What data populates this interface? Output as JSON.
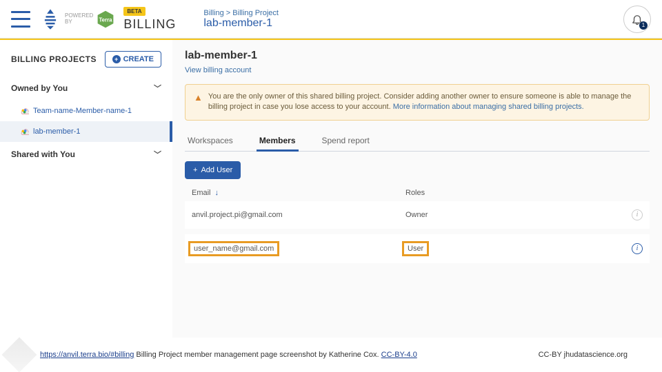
{
  "header": {
    "powered_label": "POWERED\nBY",
    "beta_label": "BETA",
    "billing_label": "BILLING",
    "breadcrumb_billing": "Billing",
    "breadcrumb_sep": ">",
    "breadcrumb_project": "Billing Project",
    "project_name": "lab-member-1",
    "notification_count": "1"
  },
  "sidebar": {
    "title": "BILLING PROJECTS",
    "create_label": "CREATE",
    "owned_label": "Owned by You",
    "shared_label": "Shared with You",
    "projects": [
      {
        "name": "Team-name-Member-name-1"
      },
      {
        "name": "lab-member-1"
      }
    ]
  },
  "main": {
    "title": "lab-member-1",
    "view_link": "View billing account",
    "warning_text": "You are the only owner of this shared billing project. Consider adding another owner to ensure someone is able to manage the billing project in case you lose access to your account. ",
    "warning_link": "More information about managing shared billing projects.",
    "tabs": {
      "workspaces": "Workspaces",
      "members": "Members",
      "spend": "Spend report"
    },
    "add_user_label": "Add User",
    "col_email": "Email",
    "col_roles": "Roles",
    "rows": [
      {
        "email": "anvil.project.pi@gmail.com",
        "role": "Owner",
        "highlighted": false,
        "info_blue": false
      },
      {
        "email": "user_name@gmail.com",
        "role": "User",
        "highlighted": true,
        "info_blue": true
      }
    ]
  },
  "footer": {
    "url": "https://anvil.terra.bio/#billing",
    "text": " Billing Project member management page screenshot by Katherine Cox.  ",
    "license": "CC-BY-4.0",
    "attribution": "CC-BY  jhudatascience.org"
  }
}
